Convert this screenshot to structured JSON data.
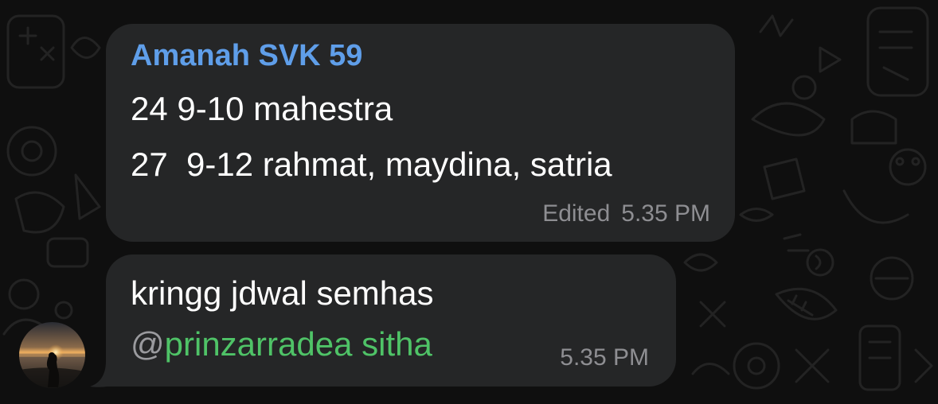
{
  "messages": [
    {
      "sender": "Amanah SVK 59",
      "lines": [
        "24 9-10 mahestra",
        "27  9-12 rahmat, maydina, satria"
      ],
      "edited_label": "Edited",
      "time": "5.35 PM"
    },
    {
      "lines": [
        "kringg jdwal semhas"
      ],
      "mention_at": "@",
      "mention_name": "prinzarradea sitha",
      "time": "5.35 PM"
    }
  ],
  "colors": {
    "background": "#0f0f0f",
    "bubble": "#252627",
    "sender_name": "#5f9ee9",
    "mention": "#4fc367",
    "meta_text": "#8e8e92"
  },
  "icons": {
    "wallpaper": "doodle-pattern",
    "avatar": "sunset-silhouette-photo"
  }
}
